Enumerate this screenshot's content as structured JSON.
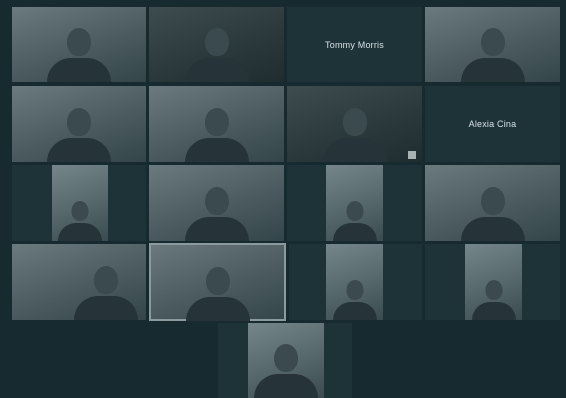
{
  "meeting": {
    "participants": [
      {
        "id": "p1",
        "label": ""
      },
      {
        "id": "p2",
        "label": ""
      },
      {
        "id": "p3",
        "label": "Tommy Morris"
      },
      {
        "id": "p4",
        "label": ""
      },
      {
        "id": "p5",
        "label": ""
      },
      {
        "id": "p6",
        "label": ""
      },
      {
        "id": "p7",
        "label": ""
      },
      {
        "id": "p8",
        "label": "Alexia Cina"
      },
      {
        "id": "p9",
        "label": ""
      },
      {
        "id": "p10",
        "label": ""
      },
      {
        "id": "p11",
        "label": ""
      },
      {
        "id": "p12",
        "label": ""
      },
      {
        "id": "p13",
        "label": ""
      },
      {
        "id": "p14",
        "label": ""
      },
      {
        "id": "p15",
        "label": ""
      },
      {
        "id": "p16",
        "label": ""
      },
      {
        "id": "p17",
        "label": ""
      }
    ]
  },
  "colors": {
    "background": "#162a30",
    "tile": "#1d3338",
    "active_outline": "#8a9a9d",
    "name_text": "#d7e2e4"
  }
}
